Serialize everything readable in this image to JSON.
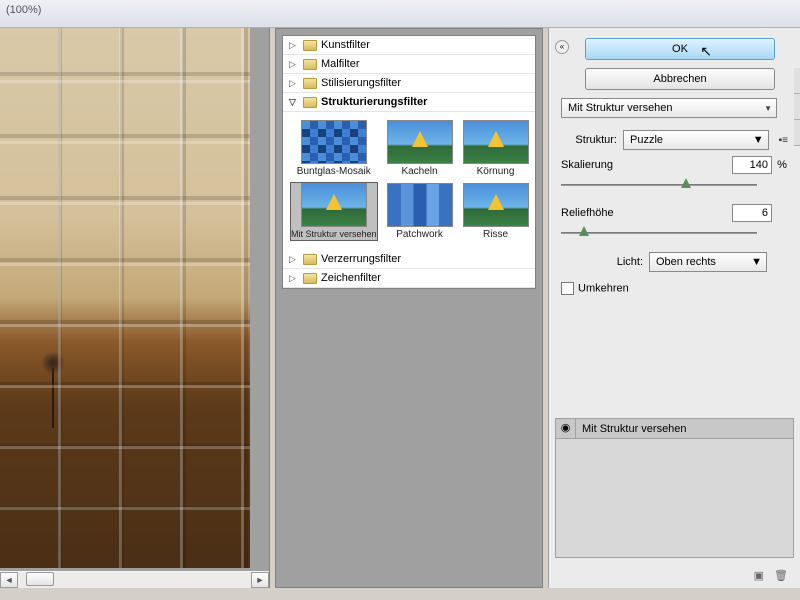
{
  "titlebar": {
    "zoom": "(100%)"
  },
  "categories": [
    {
      "label": "Kunstfilter",
      "expanded": false
    },
    {
      "label": "Malfilter",
      "expanded": false
    },
    {
      "label": "Stilisierungsfilter",
      "expanded": false
    },
    {
      "label": "Strukturierungsfilter",
      "expanded": true
    },
    {
      "label": "Verzerrungsfilter",
      "expanded": false
    },
    {
      "label": "Zeichenfilter",
      "expanded": false
    }
  ],
  "thumbs": [
    {
      "label": "Buntglas-Mosaik"
    },
    {
      "label": "Kacheln"
    },
    {
      "label": "Körnung"
    },
    {
      "label": "Mit Struktur versehen"
    },
    {
      "label": "Patchwork"
    },
    {
      "label": "Risse"
    }
  ],
  "buttons": {
    "ok": "OK",
    "cancel": "Abbrechen"
  },
  "filter_dd": "Mit Struktur versehen",
  "struktur": {
    "label": "Struktur:",
    "value": "Puzzle"
  },
  "skalierung": {
    "label": "Skalierung",
    "value": "140",
    "unit": "%"
  },
  "relief": {
    "label": "Reliefhöhe",
    "value": "6"
  },
  "licht": {
    "label": "Licht:",
    "value": "Oben rechts"
  },
  "umkehren": {
    "label": "Umkehren"
  },
  "layer": {
    "name": "Mit Struktur versehen"
  }
}
